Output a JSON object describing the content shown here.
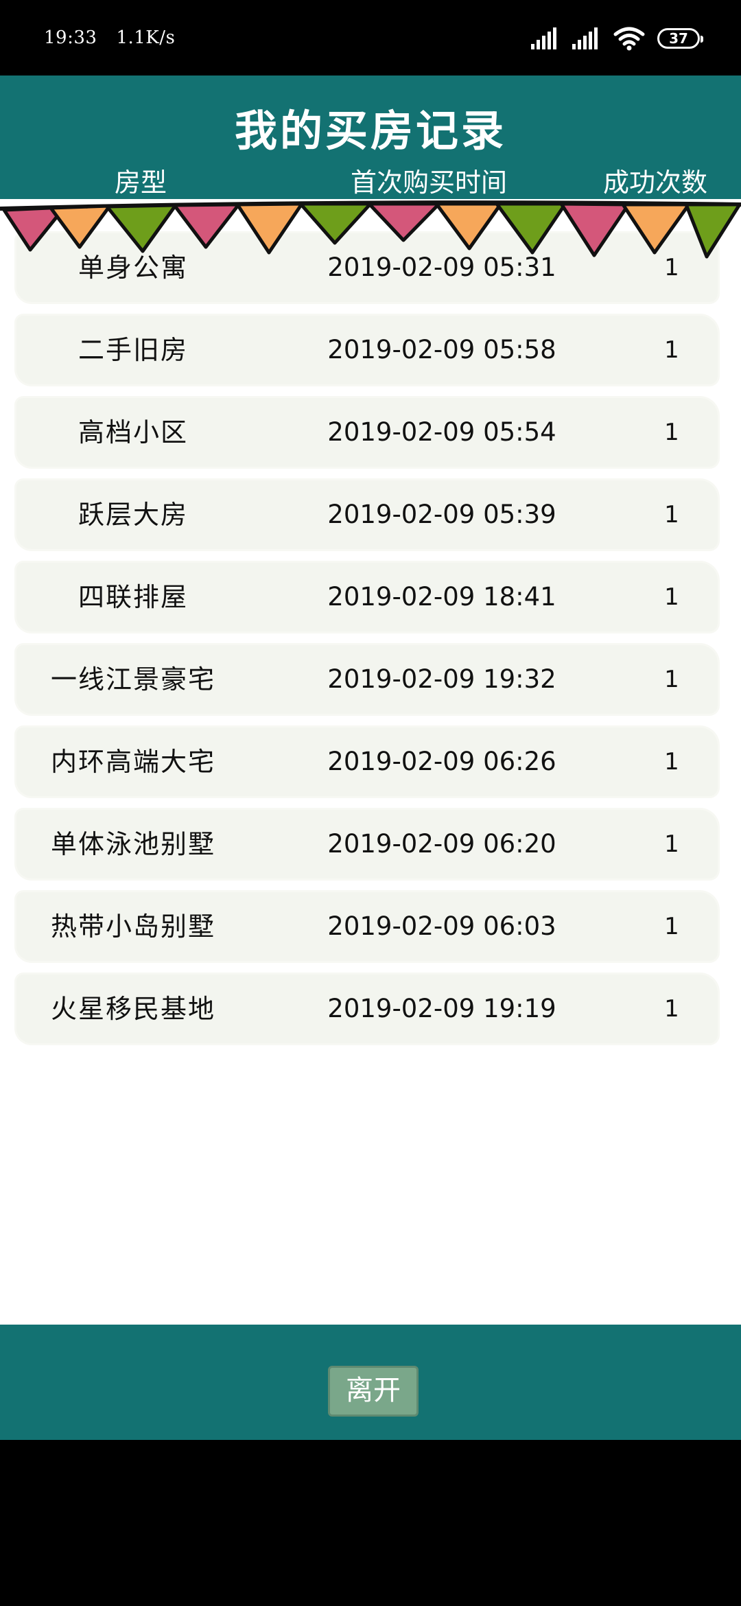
{
  "status_bar": {
    "time": "19:33",
    "speed": "1.1K/s",
    "battery": "37"
  },
  "header": {
    "title": "我的买房记录",
    "columns": [
      "房型",
      "首次购买时间",
      "成功次数"
    ]
  },
  "records": [
    {
      "type": "单身公寓",
      "time": "2019-02-09 05:31",
      "count": "1"
    },
    {
      "type": "二手旧房",
      "time": "2019-02-09 05:58",
      "count": "1"
    },
    {
      "type": "高档小区",
      "time": "2019-02-09 05:54",
      "count": "1"
    },
    {
      "type": "跃层大房",
      "time": "2019-02-09 05:39",
      "count": "1"
    },
    {
      "type": "四联排屋",
      "time": "2019-02-09 18:41",
      "count": "1"
    },
    {
      "type": "一线江景豪宅",
      "time": "2019-02-09 19:32",
      "count": "1"
    },
    {
      "type": "内环高端大宅",
      "time": "2019-02-09 06:26",
      "count": "1"
    },
    {
      "type": "单体泳池别墅",
      "time": "2019-02-09 06:20",
      "count": "1"
    },
    {
      "type": "热带小岛别墅",
      "time": "2019-02-09 06:03",
      "count": "1"
    },
    {
      "type": "火星移民基地",
      "time": "2019-02-09 19:19",
      "count": "1"
    }
  ],
  "footer": {
    "leave_label": "离开"
  },
  "colors": {
    "header_bg": "#137272",
    "row_bg": "#f3f5ef",
    "flag_pink": "#d4577a",
    "flag_orange": "#f6a75a",
    "flag_green": "#6e9e1b",
    "button_bg": "#7aa78a"
  }
}
